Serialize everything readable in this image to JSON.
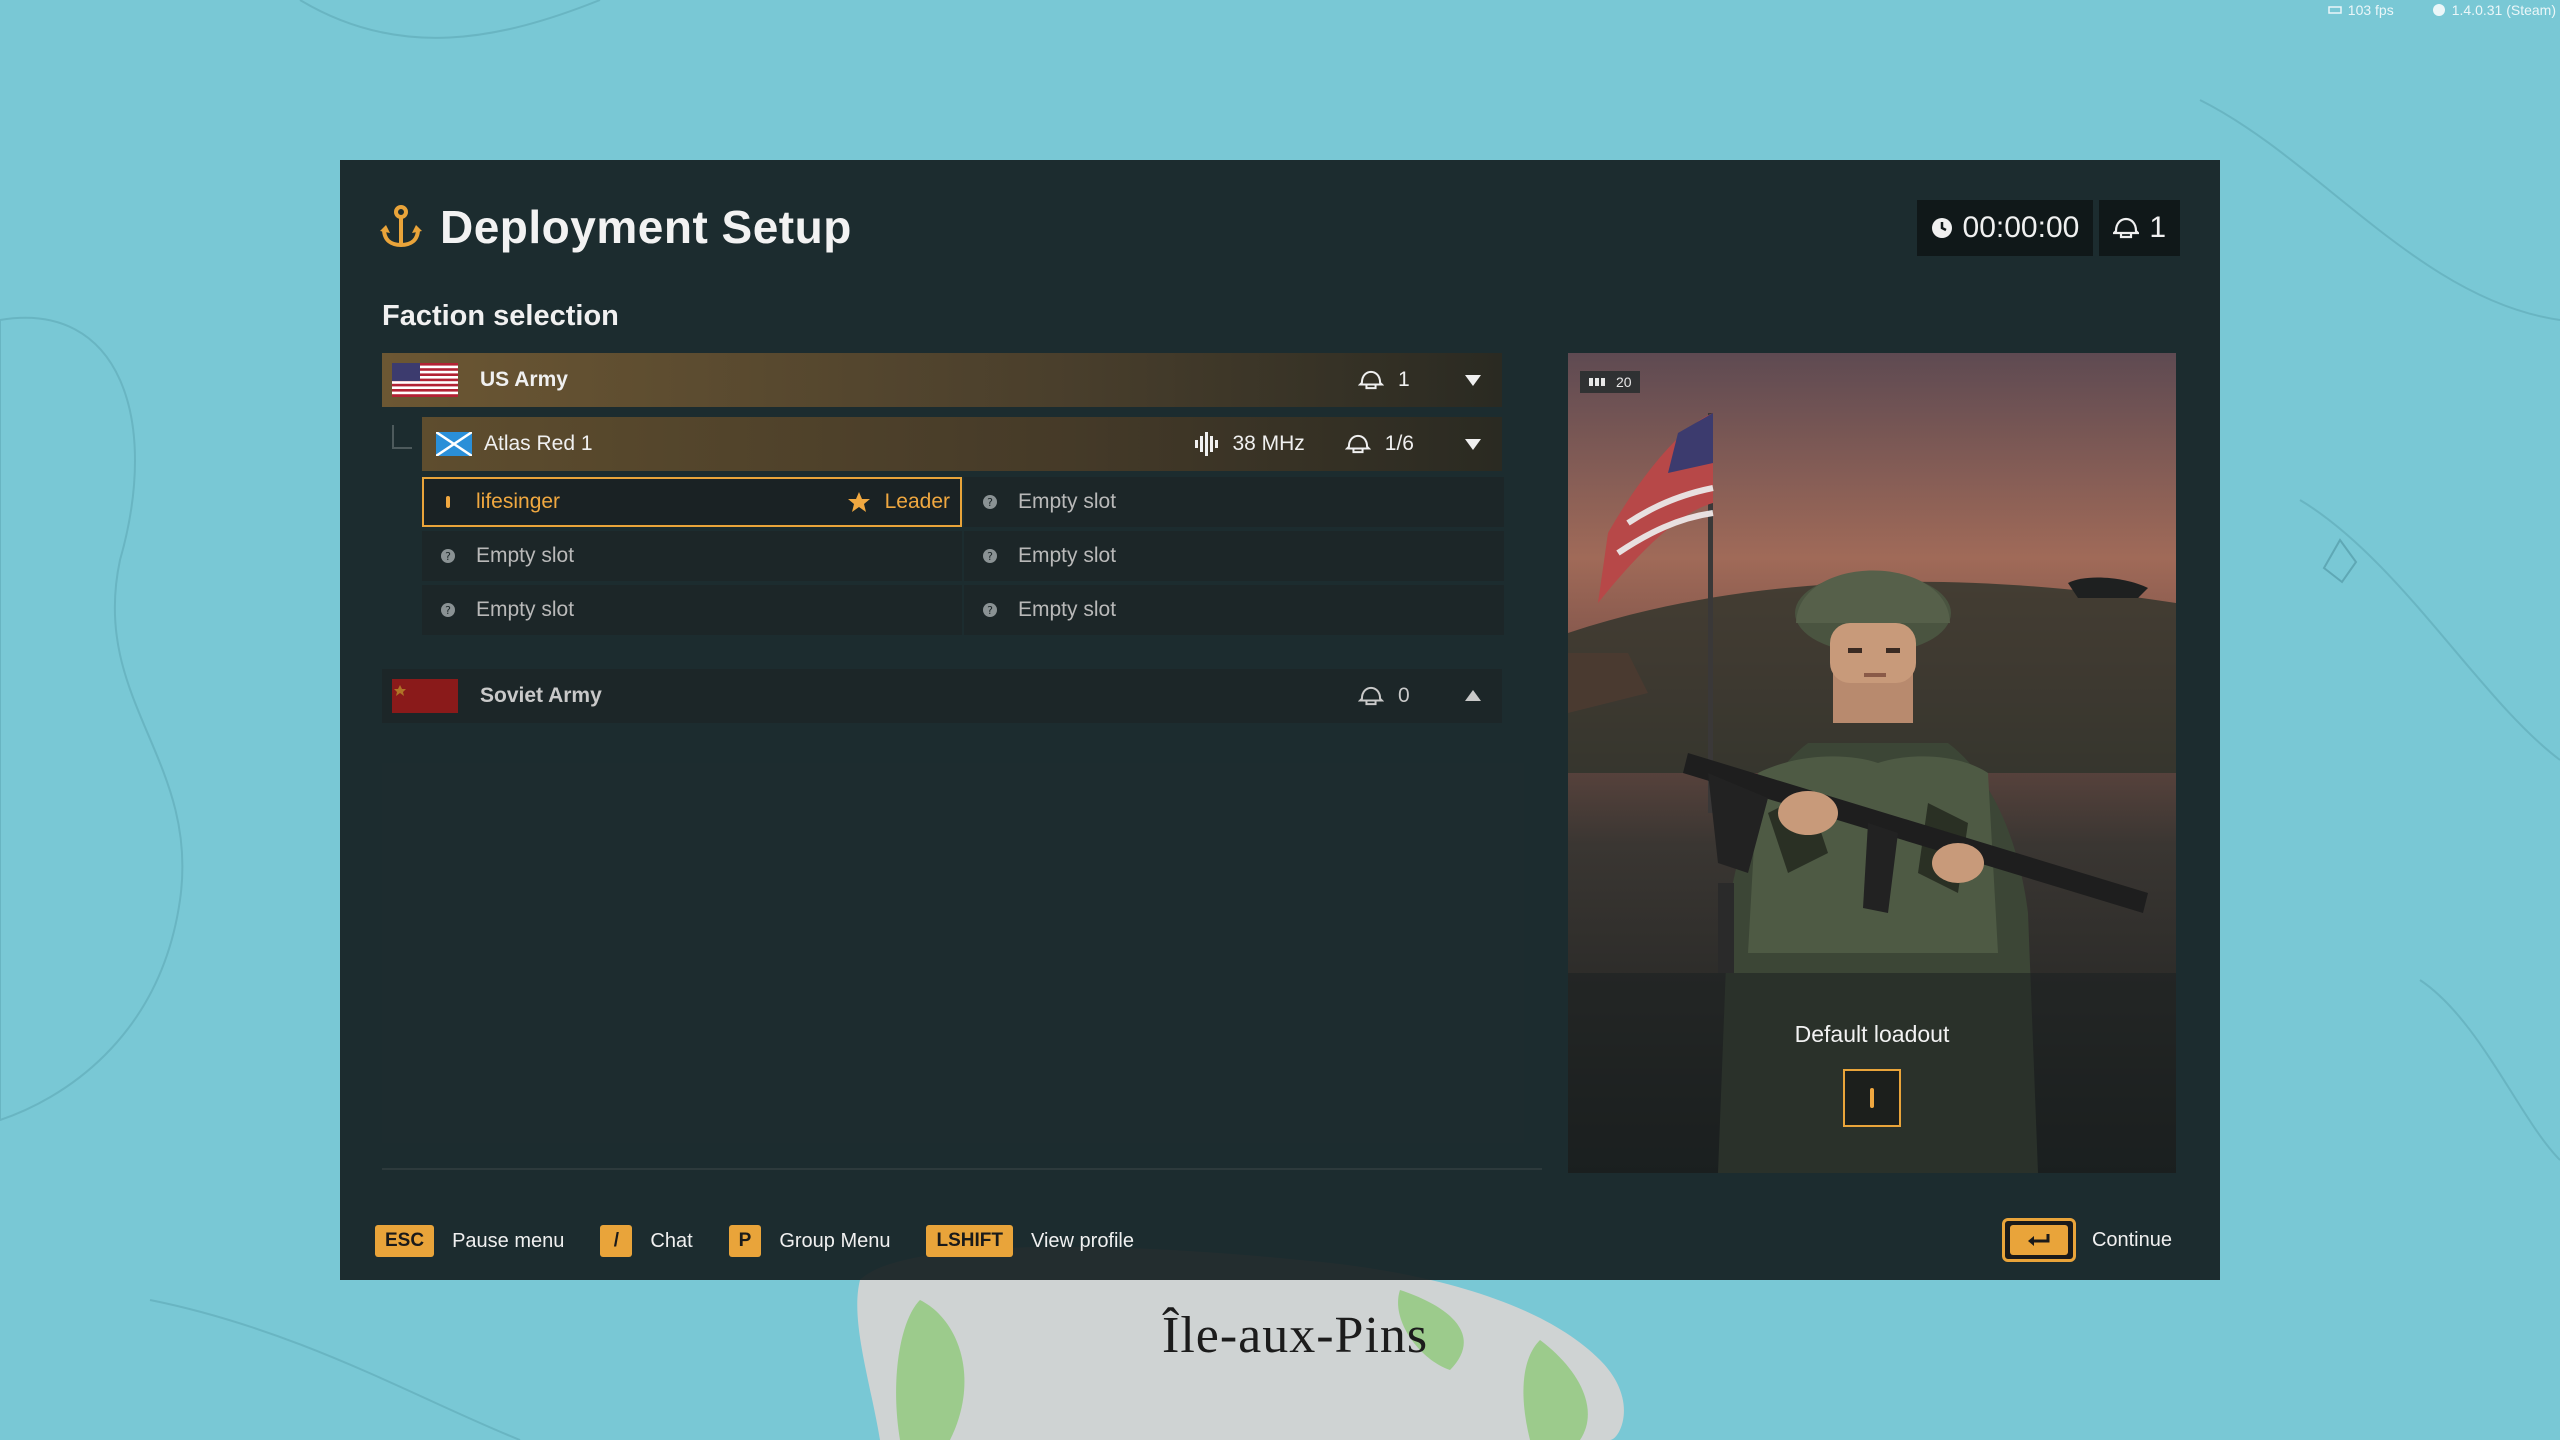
{
  "overlay": {
    "fps": "103 fps",
    "version": "1.4.0.31 (Steam)"
  },
  "map": {
    "location_label": "Île-aux-Pins"
  },
  "header": {
    "title": "Deployment Setup",
    "icon": "anchor-icon",
    "timer": "00:00:00",
    "player_count": "1"
  },
  "faction_section": {
    "title": "Faction selection"
  },
  "factions": [
    {
      "name": "US Army",
      "count": "1",
      "expanded": true,
      "group": {
        "name": "Atlas Red 1",
        "frequency": "38 MHz",
        "slots_count": "1/6"
      }
    },
    {
      "name": "Soviet Army",
      "count": "0",
      "expanded": false
    }
  ],
  "slots": {
    "player_name": "lifesinger",
    "leader_label": "Leader",
    "empty_label": "Empty slot"
  },
  "loadout": {
    "ammo_count": "20",
    "label": "Default loadout"
  },
  "footer": {
    "keys": [
      {
        "key": "ESC",
        "label": "Pause menu"
      },
      {
        "key": "/",
        "label": "Chat"
      },
      {
        "key": "P",
        "label": "Group Menu"
      },
      {
        "key": "LSHIFT",
        "label": "View profile"
      }
    ],
    "continue_label": "Continue"
  },
  "colors": {
    "accent": "#e9a43a",
    "panel": "#162022"
  }
}
